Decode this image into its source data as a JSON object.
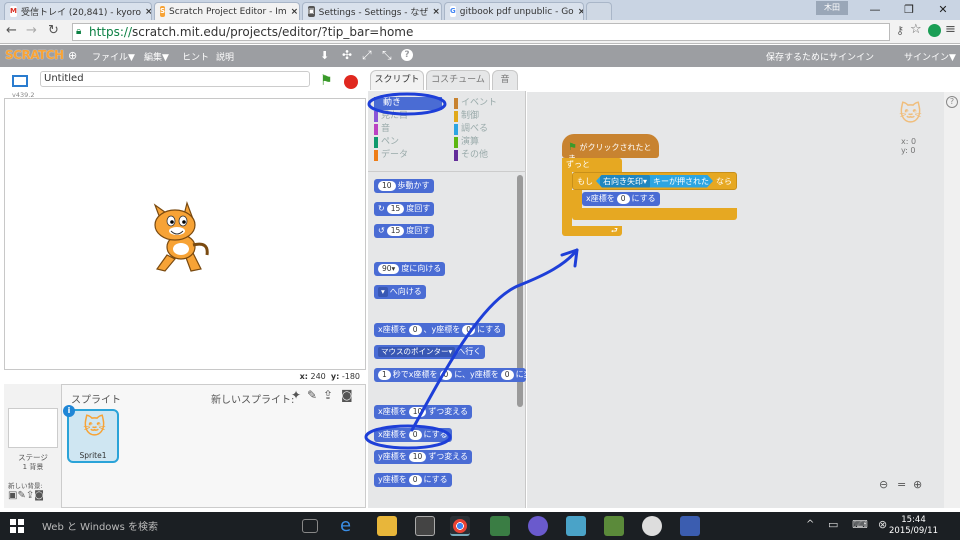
{
  "browser": {
    "tabs": [
      {
        "label": "受信トレイ (20,841) - kyoro",
        "icon": "gmail-icon",
        "color": "#d93025"
      },
      {
        "label": "Scratch Project Editor - Im",
        "icon": "scratch-icon",
        "color": "#f7a336"
      },
      {
        "label": "Settings - Settings - なぜ",
        "icon": "settings-icon",
        "color": "#444"
      },
      {
        "label": "gitbook pdf unpublic - Go",
        "icon": "google-icon",
        "color": "#4285f4"
      }
    ],
    "user_badge": "木田",
    "url_scheme": "https://",
    "url_rest": "scratch.mit.edu/projects/editor/?tip_bar=home"
  },
  "scratch_menu": {
    "logo": "SCRATCH",
    "items": [
      "ファイル▼",
      "編集▼",
      "ヒント",
      "説明"
    ],
    "save_notice": "保存するためにサインイン",
    "signin": "サインイン▼"
  },
  "stage": {
    "title": "Untitled",
    "version": "v439.2",
    "coord_x_label": "x:",
    "coord_x": "240",
    "coord_y_label": "y:",
    "coord_y": "-180"
  },
  "sprites": {
    "heading": "スプライト",
    "new_sprite_label": "新しいスプライト:",
    "stage_label": "ステージ",
    "backdrop_count": "1 背景",
    "new_backdrop_label": "新しい背景:",
    "sprite_name": "Sprite1"
  },
  "editor_tabs": [
    "スクリプト",
    "コスチューム",
    "音"
  ],
  "categories": [
    {
      "label": "動き",
      "color": "#4a6cd4"
    },
    {
      "label": "イベント",
      "color": "#c88330"
    },
    {
      "label": "見た目",
      "color": "#8a55d7"
    },
    {
      "label": "制御",
      "color": "#e1a91a"
    },
    {
      "label": "音",
      "color": "#bb42c3"
    },
    {
      "label": "調べる",
      "color": "#2ca5e2"
    },
    {
      "label": "ペン",
      "color": "#0e9a6c"
    },
    {
      "label": "演算",
      "color": "#5cb712"
    },
    {
      "label": "データ",
      "color": "#ee7d16"
    },
    {
      "label": "その他",
      "color": "#632d99"
    }
  ],
  "palette_blocks": {
    "move": {
      "n": "10",
      "t": "歩動かす"
    },
    "turn_right": {
      "n": "15",
      "t": "度回す"
    },
    "turn_left": {
      "n": "15",
      "t": "度回す"
    },
    "point_dir": {
      "n": "90▾",
      "t": "度に向ける"
    },
    "point_towards": {
      "t": "へ向ける"
    },
    "goto_xy": {
      "a": "x座標を",
      "x": "0",
      "b": "、y座標を",
      "y": "0",
      "c": "にする"
    },
    "goto": {
      "d": "マウスのポインター▾",
      "t": "へ行く"
    },
    "glide": {
      "n": "1",
      "a": "秒でx座標を",
      "x": "0",
      "b": "に、y座標を",
      "y": "0",
      "c": "に変"
    },
    "change_x": {
      "a": "x座標を",
      "n": "10",
      "t": "ずつ変える"
    },
    "set_x": {
      "a": "x座標を",
      "n": "0",
      "t": "にする"
    },
    "change_y": {
      "a": "y座標を",
      "n": "10",
      "t": "ずつ変える"
    },
    "set_y": {
      "a": "y座標を",
      "n": "0",
      "t": "にする"
    }
  },
  "script": {
    "hat": "がクリックされたとき",
    "forever": "ずっと",
    "if_a": "もし",
    "if_key": "右向き矢印▾",
    "if_b": "キーが押された",
    "if_c": "なら",
    "set_x_a": "x座標を",
    "set_x_n": "0",
    "set_x_b": "にする"
  },
  "sprite_info": {
    "x": "x: 0",
    "y": "y: 0"
  },
  "taskbar": {
    "search": "Web と Windows を検索",
    "time": "15:44",
    "date": "2015/09/11"
  },
  "colors": {
    "annotation": "#1e3fd8",
    "motion": "#4a6cd4",
    "control": "#e6a822",
    "event": "#c88330"
  }
}
